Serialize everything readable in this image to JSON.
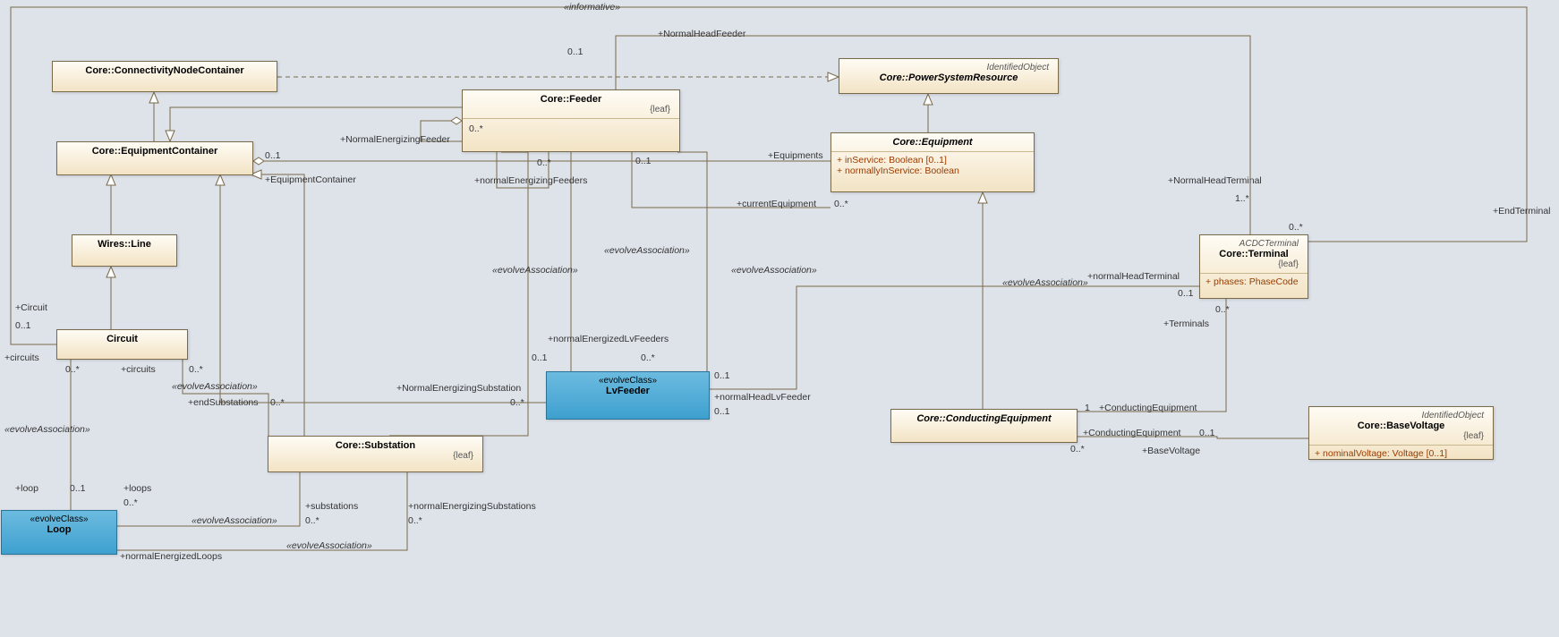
{
  "diagramType": "UML Class Diagram",
  "classes": {
    "connectivityNodeContainer": {
      "stereo": "",
      "title": "Core::ConnectivityNodeContainer",
      "leaf": "",
      "attrs": []
    },
    "equipmentContainer": {
      "stereo": "",
      "title": "Core::EquipmentContainer",
      "leaf": "",
      "attrs": []
    },
    "wiresLine": {
      "stereo": "",
      "title": "Wires::Line",
      "leaf": "",
      "attrs": []
    },
    "circuit": {
      "stereo": "",
      "title": "Circuit",
      "leaf": "",
      "attrs": []
    },
    "loop": {
      "stereo": "«evolveClass»",
      "title": "Loop",
      "leaf": "",
      "attrs": []
    },
    "feeder": {
      "stereo": "",
      "title": "Core::Feeder",
      "leaf": "{leaf}",
      "attrs": []
    },
    "substation": {
      "stereo": "",
      "title": "Core::Substation",
      "leaf": "{leaf}",
      "attrs": []
    },
    "lvFeeder": {
      "stereo": "«evolveClass»",
      "title": "LvFeeder",
      "leaf": "",
      "attrs": []
    },
    "powerSystemResource": {
      "stereo": "IdentifiedObject",
      "title": "Core::PowerSystemResource",
      "leaf": "",
      "attrs": []
    },
    "equipment": {
      "stereo": "",
      "title": "Core::Equipment",
      "leaf": "",
      "attrs": [
        "+  inService: Boolean [0..1]",
        "+  normallyInService: Boolean"
      ]
    },
    "conductingEquipment": {
      "stereo": "",
      "title": "Core::ConductingEquipment",
      "leaf": "",
      "attrs": []
    },
    "terminal": {
      "stereo": "ACDCTerminal",
      "title": "Core::Terminal",
      "leaf": "{leaf}",
      "attrs": [
        "+  phases: PhaseCode"
      ]
    },
    "baseVoltage": {
      "stereo": "IdentifiedObject",
      "title": "Core::BaseVoltage",
      "leaf": "{leaf}",
      "attrs": [
        "+  nominalVoltage: Voltage [0..1]"
      ]
    }
  },
  "chart_data": {
    "type": "uml-class-diagram",
    "nodes": [
      {
        "id": "connectivityNodeContainer",
        "name": "Core::ConnectivityNodeContainer"
      },
      {
        "id": "equipmentContainer",
        "name": "Core::EquipmentContainer"
      },
      {
        "id": "wiresLine",
        "name": "Wires::Line"
      },
      {
        "id": "circuit",
        "name": "Circuit"
      },
      {
        "id": "loop",
        "name": "Loop",
        "stereotype": "evolveClass"
      },
      {
        "id": "feeder",
        "name": "Core::Feeder",
        "constraint": "leaf"
      },
      {
        "id": "substation",
        "name": "Core::Substation",
        "constraint": "leaf"
      },
      {
        "id": "lvFeeder",
        "name": "LvFeeder",
        "stereotype": "evolveClass"
      },
      {
        "id": "powerSystemResource",
        "name": "Core::PowerSystemResource",
        "parentStereo": "IdentifiedObject",
        "abstract": true
      },
      {
        "id": "equipment",
        "name": "Core::Equipment",
        "abstract": true,
        "attributes": [
          "inService: Boolean [0..1]",
          "normallyInService: Boolean"
        ]
      },
      {
        "id": "conductingEquipment",
        "name": "Core::ConductingEquipment",
        "abstract": true
      },
      {
        "id": "terminal",
        "name": "Core::Terminal",
        "constraint": "leaf",
        "parentStereo": "ACDCTerminal",
        "attributes": [
          "phases: PhaseCode"
        ]
      },
      {
        "id": "baseVoltage",
        "name": "Core::BaseVoltage",
        "constraint": "leaf",
        "parentStereo": "IdentifiedObject",
        "attributes": [
          "nominalVoltage: Voltage [0..1]"
        ]
      }
    ],
    "edges": [
      {
        "type": "generalization",
        "from": "equipmentContainer",
        "to": "connectivityNodeContainer"
      },
      {
        "type": "generalization",
        "from": "wiresLine",
        "to": "equipmentContainer"
      },
      {
        "type": "generalization",
        "from": "circuit",
        "to": "wiresLine"
      },
      {
        "type": "generalization",
        "from": "feeder",
        "to": "equipmentContainer"
      },
      {
        "type": "generalization",
        "from": "lvFeeder",
        "to": "equipmentContainer"
      },
      {
        "type": "generalization",
        "from": "substation",
        "to": "equipmentContainer"
      },
      {
        "type": "generalization",
        "from": "equipment",
        "to": "powerSystemResource"
      },
      {
        "type": "generalization",
        "from": "conductingEquipment",
        "to": "equipment"
      },
      {
        "type": "realization",
        "from": "connectivityNodeContainer",
        "to": "powerSystemResource",
        "label": "«informative»"
      },
      {
        "type": "association",
        "from": "feeder",
        "to": "terminal",
        "roles": [
          {
            "name": "+NormalHeadFeeder",
            "mult": "0..1"
          },
          {
            "name": "+NormalHeadTerminal",
            "mult": "1..*"
          }
        ]
      },
      {
        "type": "association",
        "from": "circuit",
        "to": "terminal",
        "roles": [
          {
            "name": "+Circuit",
            "mult": "0..1"
          },
          {
            "name": "+EndTerminal",
            "mult": "0..*"
          }
        ]
      },
      {
        "type": "aggregation",
        "from": "equipmentContainer",
        "to": "equipment",
        "roles": [
          {
            "name": "+EquipmentContainer",
            "mult": "0..1"
          },
          {
            "name": "+Equipments",
            "mult": "0..*"
          }
        ]
      },
      {
        "type": "association",
        "stereotype": "evolveAssociation",
        "from": "feeder",
        "to": "equipment",
        "roles": [
          {
            "name": "+currentEquipment",
            "mult": "0..*"
          },
          {
            "name": "",
            "mult": "0..*"
          }
        ]
      },
      {
        "type": "association",
        "from": "substation",
        "to": "feeder",
        "roles": [
          {
            "name": "+NormalEnergizingSubstation",
            "mult": "0..1"
          },
          {
            "name": "",
            "mult": "0..*"
          }
        ]
      },
      {
        "type": "aggregation",
        "from": "feeder",
        "to": "feeder",
        "roles": [
          {
            "name": "+NormalEnergizingFeeder",
            "mult": "0..*"
          },
          {
            "name": "+normalEnergizingFeeders",
            "mult": "0..*"
          }
        ]
      },
      {
        "type": "association",
        "stereotype": "evolveAssociation",
        "from": "feeder",
        "to": "lvFeeder",
        "roles": [
          {
            "name": "",
            "mult": "0..1"
          },
          {
            "name": "+normalEnergizedLvFeeders",
            "mult": "0..*"
          }
        ]
      },
      {
        "type": "association",
        "stereotype": "evolveAssociation",
        "from": "lvFeeder",
        "to": "feeder",
        "roles": [
          {
            "name": "+normalHeadLvFeeder",
            "mult": "0..1"
          },
          {
            "name": "",
            "mult": "0..1"
          }
        ]
      },
      {
        "type": "association",
        "stereotype": "evolveAssociation",
        "from": "lvFeeder",
        "to": "terminal",
        "roles": [
          {
            "name": "",
            "mult": "0..1"
          },
          {
            "name": "+normalHeadTerminal",
            "mult": "0..1"
          }
        ]
      },
      {
        "type": "association",
        "from": "conductingEquipment",
        "to": "terminal",
        "roles": [
          {
            "name": "+ConductingEquipment",
            "mult": "1"
          },
          {
            "name": "+Terminals",
            "mult": "0..*"
          }
        ]
      },
      {
        "type": "association",
        "from": "conductingEquipment",
        "to": "baseVoltage",
        "roles": [
          {
            "name": "+ConductingEquipment",
            "mult": "0..*"
          },
          {
            "name": "+BaseVoltage",
            "mult": "0..1"
          }
        ]
      },
      {
        "type": "association",
        "from": "substation",
        "to": "circuit",
        "roles": [
          {
            "name": "+endSubstations",
            "mult": "0..*"
          },
          {
            "name": "+circuits",
            "mult": "0..*"
          }
        ],
        "stereotype": "evolveAssociation"
      },
      {
        "type": "association",
        "stereotype": "evolveAssociation",
        "from": "circuit",
        "to": "loop",
        "roles": [
          {
            "name": "+circuits",
            "mult": "0..*"
          },
          {
            "name": "+loop",
            "mult": "0..1"
          }
        ]
      },
      {
        "type": "association",
        "stereotype": "evolveAssociation",
        "from": "loop",
        "to": "substation",
        "roles": [
          {
            "name": "+loops",
            "mult": "0..*"
          },
          {
            "name": "+substations",
            "mult": "0..*"
          }
        ]
      },
      {
        "type": "association",
        "stereotype": "evolveAssociation",
        "from": "loop",
        "to": "substation",
        "roles": [
          {
            "name": "+normalEnergizedLoops",
            "mult": ""
          },
          {
            "name": "+normalEnergizingSubstations",
            "mult": "0..*"
          }
        ]
      }
    ]
  },
  "labels": {
    "informative": "«informative»",
    "normalHeadFeeder": "+NormalHeadFeeder",
    "normalHeadTerminal": "+NormalHeadTerminal",
    "oneStar": "1..*",
    "equipments": "+Equipments",
    "equipmentContainer": "+EquipmentContainer",
    "currentEquipment": "+currentEquipment",
    "normalEnergizingFeeder": "+NormalEnergizingFeeder",
    "normalEnergizingFeeders": "+normalEnergizingFeeders",
    "evolveAssoc": "«evolveAssociation»",
    "normalEnergizedLvFeeders": "+normalEnergizedLvFeeders",
    "normalHeadLvFeeder": "+normalHeadLvFeeder",
    "normalHeadTerminalL": "+normalHeadTerminal",
    "terminals": "+Terminals",
    "conductingEquipment": "+ConductingEquipment",
    "baseVoltage": "+BaseVoltage",
    "endTerminal": "+EndTerminal",
    "circuit": "+Circuit",
    "circuits": "+circuits",
    "endSubstations": "+endSubstations",
    "normalEnergizingSubstation": "+NormalEnergizingSubstation",
    "loop": "+loop",
    "loops": "+loops",
    "substations": "+substations",
    "normalEnergizedLoops": "+normalEnergizedLoops",
    "normalEnergizingSubstations": "+normalEnergizingSubstations",
    "m0_1": "0..1",
    "m0_s": "0..*",
    "m1": "1"
  }
}
